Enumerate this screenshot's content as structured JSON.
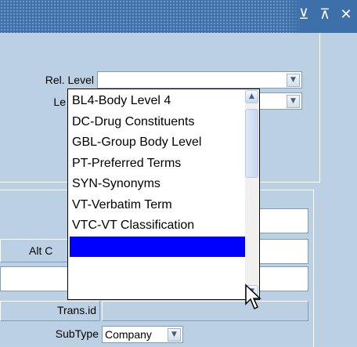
{
  "titlebar": {
    "icons": [
      "minimize-icon",
      "maximize-icon",
      "close-icon"
    ],
    "glyphs": {
      "minimize": "⊻",
      "maximize": "⊼",
      "close": "✕"
    }
  },
  "form": {
    "rel_level_label": "Rel. Level",
    "level_label_partial": "Le",
    "alt_label_partial": "Alt C",
    "trans_id_label": "Trans.id",
    "subtype_label": "SubType",
    "subtype_value": "Company"
  },
  "popup": {
    "items": [
      "BL4-Body Level 4",
      "DC-Drug Constituents",
      "GBL-Group Body Level",
      "PT-Preferred Terms",
      "SYN-Synonyms",
      "VT-Verbatim Term",
      "VTC-VT Classification",
      ""
    ],
    "selected_index": 7
  },
  "colors": {
    "title_bar": "#3d6fa8",
    "panel": "#bcd0e4",
    "selection": "#0000ff"
  }
}
